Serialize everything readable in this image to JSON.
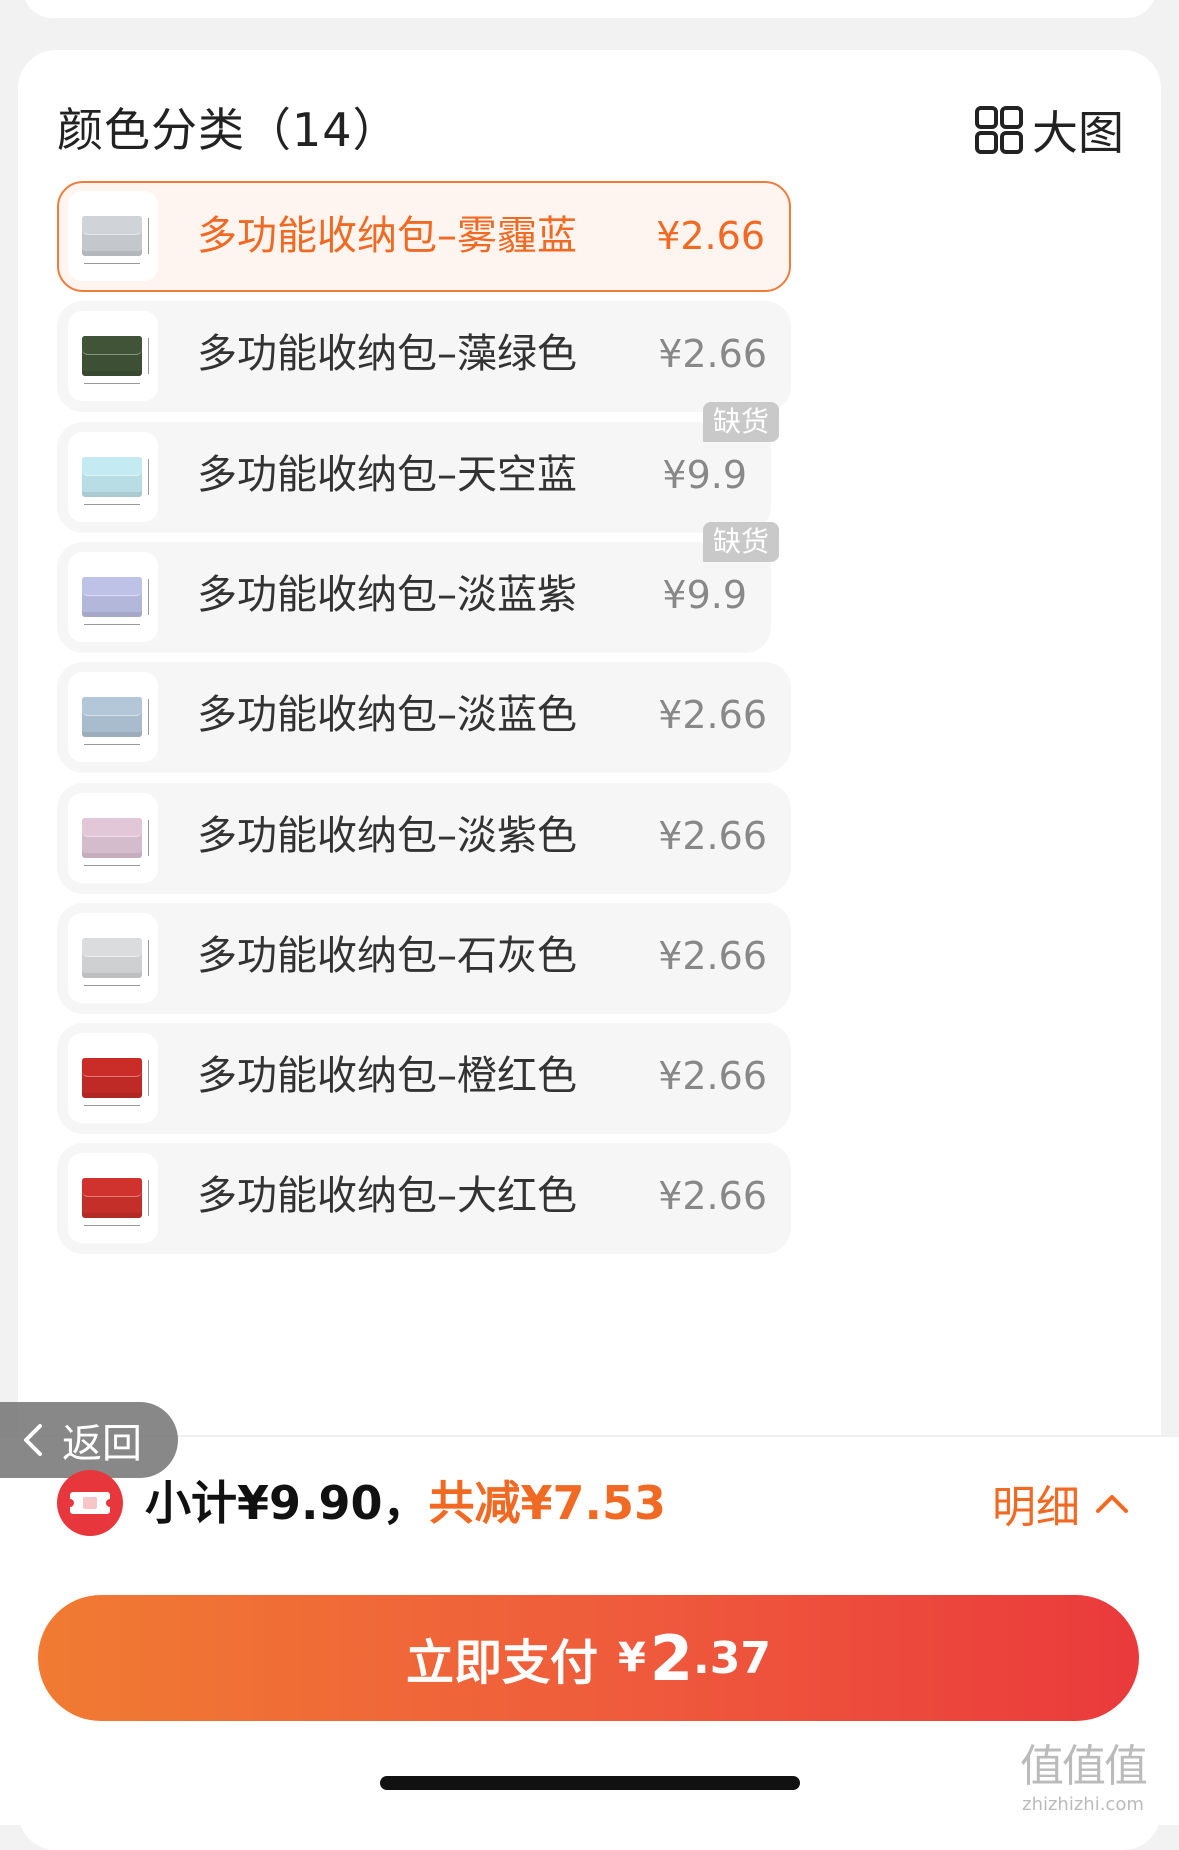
{
  "section": {
    "title": "颜色分类（14）",
    "view_toggle_label": "大图",
    "view_toggle_icon": "grid-icon"
  },
  "variants": [
    {
      "name": "多功能收纳包–雾霾蓝",
      "price": "¥2.66",
      "color": "#c4c8cd",
      "selected": true,
      "badge": ""
    },
    {
      "name": "多功能收纳包–藻绿色",
      "price": "¥2.66",
      "color": "#3d4f35",
      "selected": false,
      "badge": ""
    },
    {
      "name": "多功能收纳包–天空蓝",
      "price": "¥9.9",
      "color": "#b9dde4",
      "selected": false,
      "badge": "缺货"
    },
    {
      "name": "多功能收纳包–淡蓝紫",
      "price": "¥9.9",
      "color": "#b3b7d9",
      "selected": false,
      "badge": "缺货"
    },
    {
      "name": "多功能收纳包–淡蓝色",
      "price": "¥2.66",
      "color": "#a9bccd",
      "selected": false,
      "badge": ""
    },
    {
      "name": "多功能收纳包–淡紫色",
      "price": "¥2.66",
      "color": "#d5bccd",
      "selected": false,
      "badge": ""
    },
    {
      "name": "多功能收纳包–石灰色",
      "price": "¥2.66",
      "color": "#cfd0d1",
      "selected": false,
      "badge": ""
    },
    {
      "name": "多功能收纳包–橙红色",
      "price": "¥2.66",
      "color": "#bf2a26",
      "selected": false,
      "badge": ""
    },
    {
      "name": "多功能收纳包–大红色",
      "price": "¥2.66",
      "color": "#c42f2a",
      "selected": false,
      "badge": ""
    }
  ],
  "back_button": {
    "label": "返回",
    "icon": "chevron-left-icon"
  },
  "summary": {
    "subtotal": "小计¥9.90，",
    "discount": "共减¥7.53",
    "detail_label": "明细",
    "detail_icon": "chevron-up-icon",
    "coupon_icon": "coupon-icon"
  },
  "pay_button": {
    "label": "立即支付",
    "currency": "¥",
    "amount_int": "2",
    "amount_dec": ".37"
  },
  "watermark": {
    "main": "值值值",
    "url": "zhizhizhi.com"
  },
  "colors": {
    "accent": "#f06a24",
    "pay_gradient_start": "#f07b32",
    "pay_gradient_end": "#ea3a3c",
    "badge_bg": "#c9c9c9"
  }
}
